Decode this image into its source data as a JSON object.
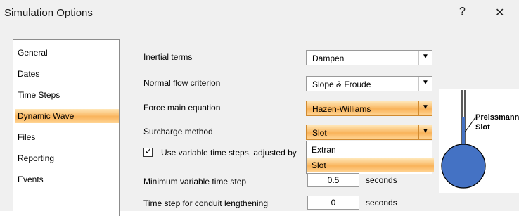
{
  "window": {
    "title": "Simulation Options",
    "help_label": "?",
    "close_label": "✕"
  },
  "sidebar": {
    "items": [
      {
        "label": "General"
      },
      {
        "label": "Dates"
      },
      {
        "label": "Time Steps"
      },
      {
        "label": "Dynamic Wave",
        "selected": true
      },
      {
        "label": "Files"
      },
      {
        "label": "Reporting"
      },
      {
        "label": "Events"
      }
    ]
  },
  "dynamic_wave": {
    "inertial_terms": {
      "label": "Inertial terms",
      "value": "Dampen"
    },
    "normal_flow": {
      "label": "Normal flow criterion",
      "value": "Slope & Froude"
    },
    "force_main": {
      "label": "Force main equation",
      "value": "Hazen-Williams"
    },
    "surcharge": {
      "label": "Surcharge method",
      "value": "Slot",
      "options": [
        "Extran",
        "Slot"
      ],
      "open": true
    },
    "variable_steps": {
      "label": "Use variable time steps, adjusted by",
      "checked": true,
      "check_glyph": "✓"
    },
    "min_step": {
      "label": "Minimum variable time step",
      "value": "0.5",
      "unit": "seconds"
    },
    "lengthening": {
      "label": "Time step for conduit lengthening",
      "value": "0",
      "unit": "seconds"
    }
  },
  "diagram": {
    "label_line1": "Preissmann",
    "label_line2": "Slot"
  },
  "colors": {
    "highlight": "#f9b35a",
    "slot_fill": "#4472c4"
  }
}
